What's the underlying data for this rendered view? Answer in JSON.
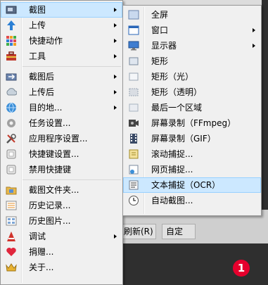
{
  "main_menu": {
    "items": [
      {
        "label": "截图",
        "has_submenu": true,
        "selected": true,
        "icon": "capture-icon"
      },
      {
        "label": "上传",
        "has_submenu": true,
        "icon": "upload-icon"
      },
      {
        "label": "快捷动作",
        "has_submenu": true,
        "icon": "quick-actions-icon"
      },
      {
        "label": "工具",
        "has_submenu": true,
        "icon": "tools-icon"
      },
      {
        "label": "截图后",
        "has_submenu": true,
        "icon": "after-capture-icon"
      },
      {
        "label": "上传后",
        "has_submenu": true,
        "icon": "after-upload-icon"
      },
      {
        "label": "目的地...",
        "has_submenu": true,
        "icon": "destinations-icon"
      },
      {
        "label": "任务设置...",
        "icon": "task-settings-icon"
      },
      {
        "label": "应用程序设置...",
        "icon": "application-settings-icon"
      },
      {
        "label": "快捷键设置...",
        "icon": "hotkey-settings-icon"
      },
      {
        "label": "禁用快捷键",
        "icon": "disable-hotkeys-icon"
      },
      {
        "label": "截图文件夹...",
        "icon": "screenshots-folder-icon"
      },
      {
        "label": "历史记录...",
        "icon": "history-icon"
      },
      {
        "label": "历史图片...",
        "icon": "image-history-icon"
      },
      {
        "label": "调试",
        "has_submenu": true,
        "icon": "debug-icon"
      },
      {
        "label": "捐赠...",
        "icon": "donate-heart-icon"
      },
      {
        "label": "关于...",
        "icon": "about-crown-icon"
      }
    ]
  },
  "capture_submenu": {
    "items": [
      {
        "label": "全屏",
        "icon": "fullscreen-icon"
      },
      {
        "label": "窗口",
        "has_submenu": true,
        "icon": "window-icon"
      },
      {
        "label": "显示器",
        "has_submenu": true,
        "icon": "monitor-icon"
      },
      {
        "label": "矩形",
        "icon": "rectangle-icon"
      },
      {
        "label": "矩形（光）",
        "icon": "rectangle-light-icon"
      },
      {
        "label": "矩形（透明）",
        "icon": "rectangle-transparent-icon"
      },
      {
        "label": "最后一个区域",
        "icon": "last-region-icon"
      },
      {
        "label": "屏幕录制（FFmpeg）",
        "icon": "screen-recording-ffmpeg-icon"
      },
      {
        "label": "屏幕录制（GIF）",
        "icon": "screen-recording-gif-icon"
      },
      {
        "label": "滚动捕捉...",
        "icon": "scrolling-capture-icon"
      },
      {
        "label": "网页捕捉...",
        "icon": "webpage-capture-icon"
      },
      {
        "label": "文本捕捉（OCR）",
        "selected": true,
        "icon": "text-capture-ocr-icon"
      },
      {
        "label": "自动截图...",
        "icon": "auto-capture-clock-icon"
      }
    ]
  },
  "background": {
    "button_1": "刷新(R)",
    "button_2": "自定",
    "badge": "1"
  },
  "colors": {
    "menu_bg": "#f0f0f0",
    "selection": "#cce8ff",
    "selection_border": "#99d1ff",
    "badge": "#e6002d"
  }
}
